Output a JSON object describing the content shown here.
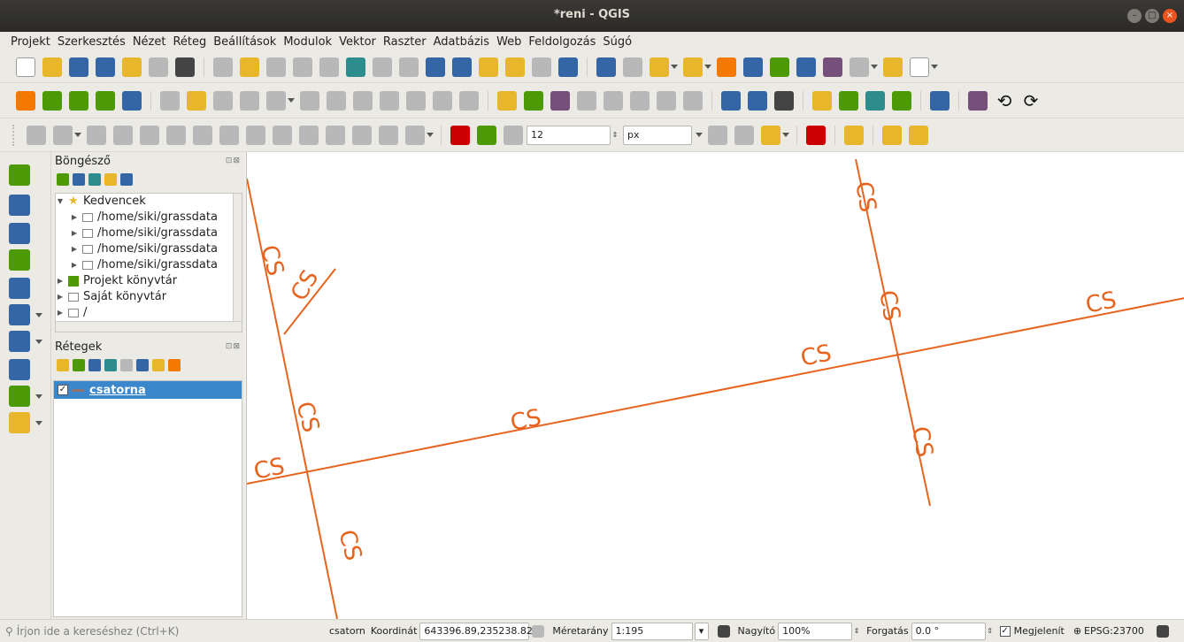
{
  "window": {
    "title": "*reni - QGIS"
  },
  "menubar": [
    "Projekt",
    "Szerkesztés",
    "Nézet",
    "Réteg",
    "Beállítások",
    "Modulok",
    "Vektor",
    "Raszter",
    "Adatbázis",
    "Web",
    "Feldolgozás",
    "Súgó"
  ],
  "toolbar": {
    "symbol_size": "12",
    "unit": "px"
  },
  "browser_panel": {
    "title": "Böngésző",
    "items": [
      {
        "label": "Kedvencek",
        "icon": "star-icon"
      },
      {
        "label": "/home/siki/grassdata",
        "icon": "folder-icon"
      },
      {
        "label": "/home/siki/grassdata",
        "icon": "folder-icon"
      },
      {
        "label": "/home/siki/grassdata",
        "icon": "folder-icon"
      },
      {
        "label": "/home/siki/grassdata",
        "icon": "folder-icon"
      },
      {
        "label": "Projekt könyvtár",
        "icon": "project-folder-icon"
      },
      {
        "label": "Saját könyvtár",
        "icon": "home-folder-icon"
      },
      {
        "label": "/",
        "icon": "folder-icon"
      }
    ]
  },
  "layers_panel": {
    "title": "Rétegek",
    "layers": [
      {
        "name": "csatorna",
        "checked": true
      }
    ]
  },
  "map": {
    "line_color": "#e7641e",
    "label": "CS"
  },
  "statusbar": {
    "search_placeholder": "Írjon ide a kereséshez (Ctrl+K)",
    "layer": "csatorn",
    "coord_label": "Koordinát",
    "coord_value": "643396.89,235238.82",
    "scale_label": "Méretarány",
    "scale_value": "1:195",
    "magnifier_label": "Nagyító",
    "magnifier_value": "100%",
    "rotation_label": "Forgatás",
    "rotation_value": "0.0 °",
    "render_label": "Megjelenít",
    "crs": "EPSG:23700"
  }
}
